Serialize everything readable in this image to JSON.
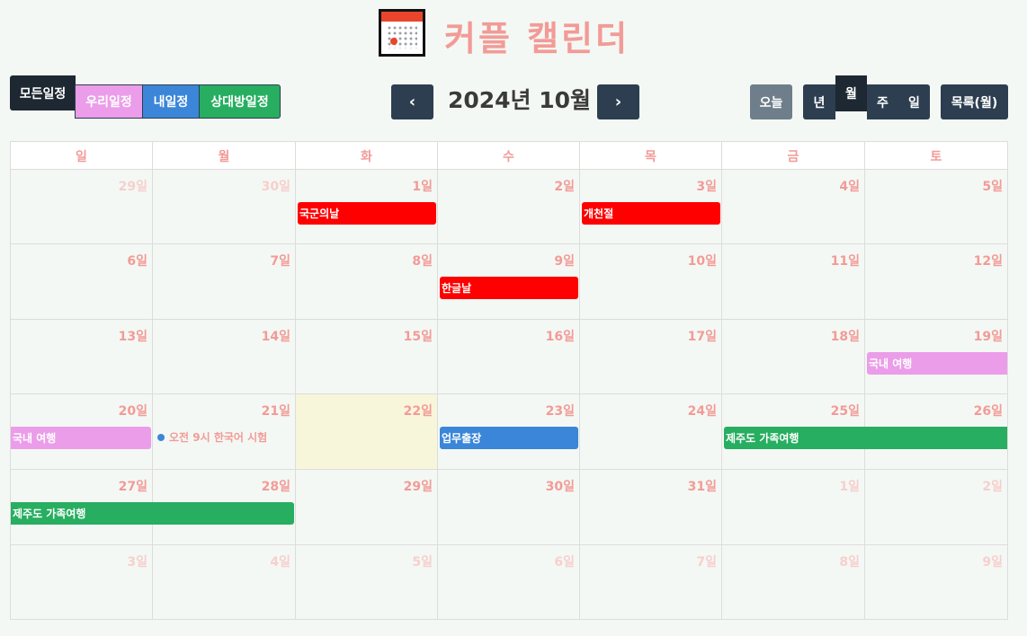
{
  "header": {
    "title": "커플 캘린더",
    "icon": "calendar-icon"
  },
  "filters": {
    "all": "모든일정",
    "ours": "우리일정",
    "mine": "내일정",
    "partner": "상대방일정"
  },
  "nav": {
    "month_title": "2024년 10월",
    "prev": "‹",
    "next": "›"
  },
  "views": {
    "today": "오늘",
    "year": "년",
    "month": "월",
    "week": "주",
    "day": "일",
    "list": "목록(월)"
  },
  "colors": {
    "holiday": "#ff0000",
    "ours": "#eb9de9",
    "mine": "#3b86d8",
    "partner": "#27ae60",
    "accent": "#f29b97",
    "today_bg": "#f8f6da"
  },
  "weekdays": [
    "일",
    "월",
    "화",
    "수",
    "목",
    "금",
    "토"
  ],
  "weeks": [
    [
      "29일",
      "30일",
      "1일",
      "2일",
      "3일",
      "4일",
      "5일"
    ],
    [
      "6일",
      "7일",
      "8일",
      "9일",
      "10일",
      "11일",
      "12일"
    ],
    [
      "13일",
      "14일",
      "15일",
      "16일",
      "17일",
      "18일",
      "19일"
    ],
    [
      "20일",
      "21일",
      "22일",
      "23일",
      "24일",
      "25일",
      "26일"
    ],
    [
      "27일",
      "28일",
      "29일",
      "30일",
      "31일",
      "1일",
      "2일"
    ],
    [
      "3일",
      "4일",
      "5일",
      "6일",
      "7일",
      "8일",
      "9일"
    ]
  ],
  "events": [
    {
      "title": "국군의날",
      "color": "#ff0000"
    },
    {
      "title": "개천절",
      "color": "#ff0000"
    },
    {
      "title": "한글날",
      "color": "#ff0000"
    },
    {
      "title": "국내 여행",
      "color": "#eb9de9"
    },
    {
      "title": "국내 여행",
      "color": "#eb9de9"
    },
    {
      "title": "오전 9시 한국어 시험",
      "color": "#3b86d8"
    },
    {
      "title": "업무출장",
      "color": "#3b86d8"
    },
    {
      "title": "제주도 가족여행",
      "color": "#27ae60"
    },
    {
      "title": "제주도 가족여행",
      "color": "#27ae60"
    }
  ]
}
